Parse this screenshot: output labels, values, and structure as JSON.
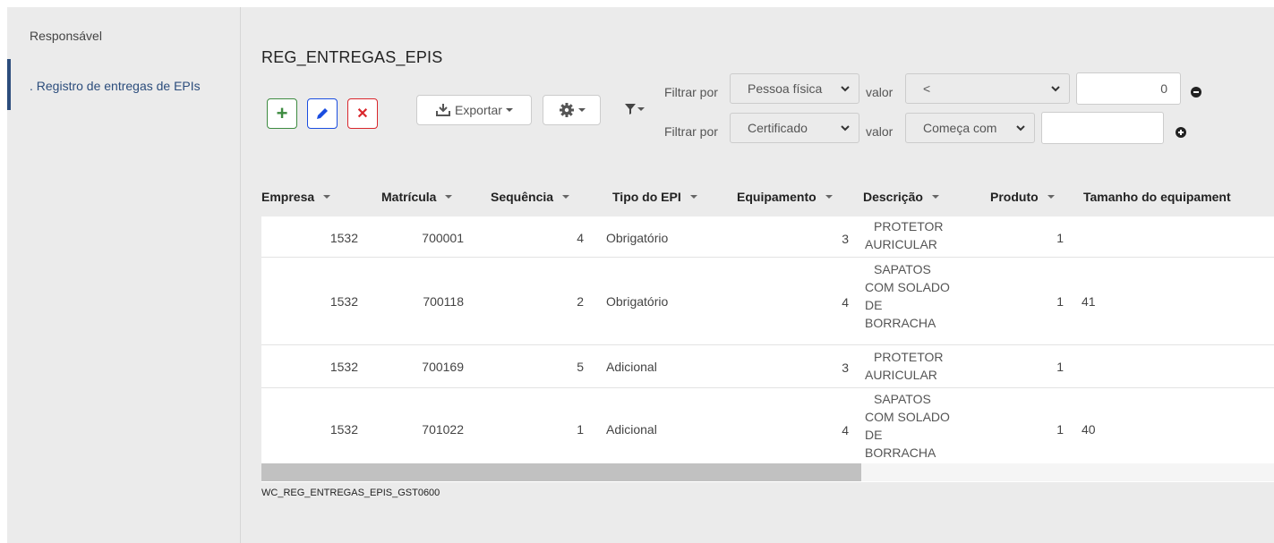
{
  "sidebar": {
    "header": "Responsável",
    "items": [
      {
        "label": ". Registro de entregas de EPIs",
        "active": true
      }
    ]
  },
  "page": {
    "title": "REG_ENTREGAS_EPIS",
    "footer_id": "WC_REG_ENTREGAS_EPIS_GST0600"
  },
  "toolbar": {
    "add_icon": "plus-icon",
    "edit_icon": "pencil-icon",
    "delete_icon": "x-icon",
    "export_label": "Exportar",
    "settings_icon": "gear-icon",
    "filter_icon": "filter-icon",
    "colors": {
      "add": "#3d8b40",
      "edit": "#1a4de0",
      "delete": "#d9262c"
    }
  },
  "filters": [
    {
      "label": "Filtrar por",
      "field": "Pessoa física",
      "value_label": "valor",
      "operator": "<",
      "value": "0",
      "action_icon": "minus-circle-icon"
    },
    {
      "label": "Filtrar por",
      "field": "Certificado",
      "value_label": "valor",
      "operator": "Começa com",
      "value": "",
      "action_icon": "plus-circle-icon"
    }
  ],
  "table": {
    "columns": [
      "Empresa",
      "Matrícula",
      "Sequência",
      "Tipo do EPI",
      "Equipamento",
      "Descrição",
      "Produto",
      "Tamanho do equipament"
    ],
    "rows": [
      {
        "empresa": "1532",
        "matricula": "700001",
        "sequencia": "4",
        "tipo": "Obrigatório",
        "equipamento": "3",
        "descricao": [
          "PROTETOR",
          "AURICULAR"
        ],
        "produto": "1",
        "tamanho": ""
      },
      {
        "empresa": "1532",
        "matricula": "700118",
        "sequencia": "2",
        "tipo": "Obrigatório",
        "equipamento": "4",
        "descricao": [
          "SAPATOS",
          "COM SOLADO",
          "DE",
          "BORRACHA"
        ],
        "produto": "1",
        "tamanho": "41"
      },
      {
        "empresa": "1532",
        "matricula": "700169",
        "sequencia": "5",
        "tipo": "Adicional",
        "equipamento": "3",
        "descricao": [
          "PROTETOR",
          "AURICULAR"
        ],
        "produto": "1",
        "tamanho": ""
      },
      {
        "empresa": "1532",
        "matricula": "701022",
        "sequencia": "1",
        "tipo": "Adicional",
        "equipamento": "4",
        "descricao": [
          "SAPATOS",
          "COM SOLADO",
          "DE",
          "BORRACHA"
        ],
        "produto": "1",
        "tamanho": "40"
      }
    ]
  }
}
